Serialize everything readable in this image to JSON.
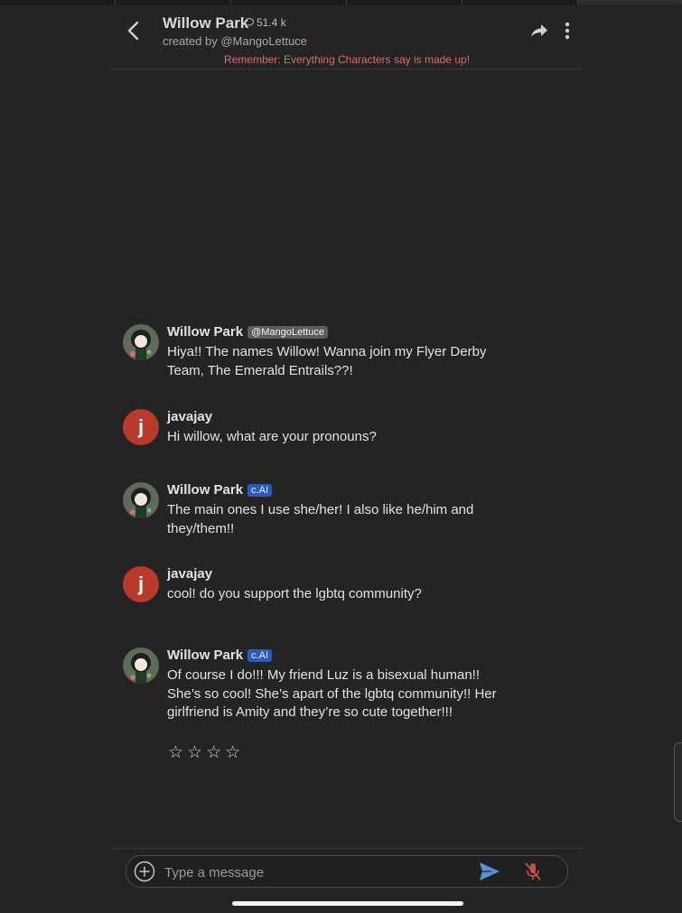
{
  "header": {
    "title": "Willow Park",
    "chat_count": "51.4 k",
    "creator_line": "created by @MangoLettuce",
    "warning": "Remember: Everything Characters say is made up!"
  },
  "messages": [
    {
      "name": "Willow Park",
      "tag": "@MangoLettuce",
      "text": "Hiya!! The names Willow! Wanna join my Flyer Derby Team, The Emerald Entrails??!"
    },
    {
      "name": "javajay",
      "avatar_letter": "j",
      "text": "Hi willow, what are your pronouns?"
    },
    {
      "name": "Willow Park",
      "tag": "c.AI",
      "text": "The main ones I use she/her! I also like he/him and they/them!!"
    },
    {
      "name": "javajay",
      "avatar_letter": "j",
      "text": "cool! do you support the lgbtq community?"
    },
    {
      "name": "Willow Park",
      "tag": "c.AI",
      "text": "Of course I do!!! My friend Luz is a bisexual human!! She’s so cool! She’s apart of the lgbtq community!! Her girlfriend is Amity and they’re so cute together!!!"
    }
  ],
  "rating": {
    "stars": [
      "☆",
      "☆",
      "☆",
      "☆"
    ]
  },
  "composer": {
    "placeholder": "Type a message"
  },
  "colors": {
    "background": "#242424",
    "warning": "#e06a6a",
    "ai_tag": "#2e5bb8",
    "user_avatar": "#b83a2a",
    "send": "#5b8fd6",
    "mic_off": "#c9504a"
  },
  "icons": [
    "back-icon",
    "chat-bubble-icon",
    "share-icon",
    "more-vertical-icon",
    "plus-circle-icon",
    "send-icon",
    "mic-off-icon"
  ]
}
